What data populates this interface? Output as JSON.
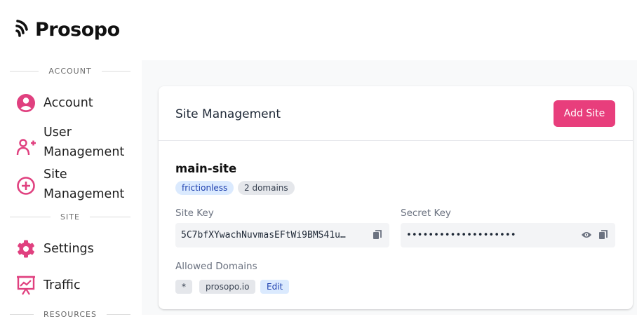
{
  "brand": {
    "name": "Prosopo"
  },
  "sidebar": {
    "sections": [
      {
        "label": "ACCOUNT"
      },
      {
        "label": "SITE"
      },
      {
        "label": "RESOURCES"
      }
    ],
    "items": [
      {
        "label": "Account",
        "icon": "user-circle-icon"
      },
      {
        "label_line1": "User",
        "label_line2": "Management",
        "icon": "user-plus-icon"
      },
      {
        "label_line1": "Site",
        "label_line2": "Management",
        "icon": "plus-circle-icon"
      },
      {
        "label": "Settings",
        "icon": "gear-icon"
      },
      {
        "label": "Traffic",
        "icon": "presentation-chart-icon"
      }
    ]
  },
  "main": {
    "title": "Site Management",
    "add_button": "Add Site",
    "site": {
      "name": "main-site",
      "tags": [
        "frictionless",
        "2 domains"
      ],
      "site_key_label": "Site Key",
      "site_key_value": "5C7bfXYwachNuvmasEFtWi9BMS41u…",
      "secret_key_label": "Secret Key",
      "secret_key_value": "••••••••••••••••••••",
      "domains_label": "Allowed Domains",
      "domains": [
        "*",
        "prosopo.io"
      ],
      "edit_label": "Edit"
    }
  },
  "colors": {
    "accent": "#e83e7c",
    "icon_pink": "#e0407f",
    "chip_blue_bg": "#dbeafe",
    "chip_gray_bg": "#e5e7eb"
  }
}
